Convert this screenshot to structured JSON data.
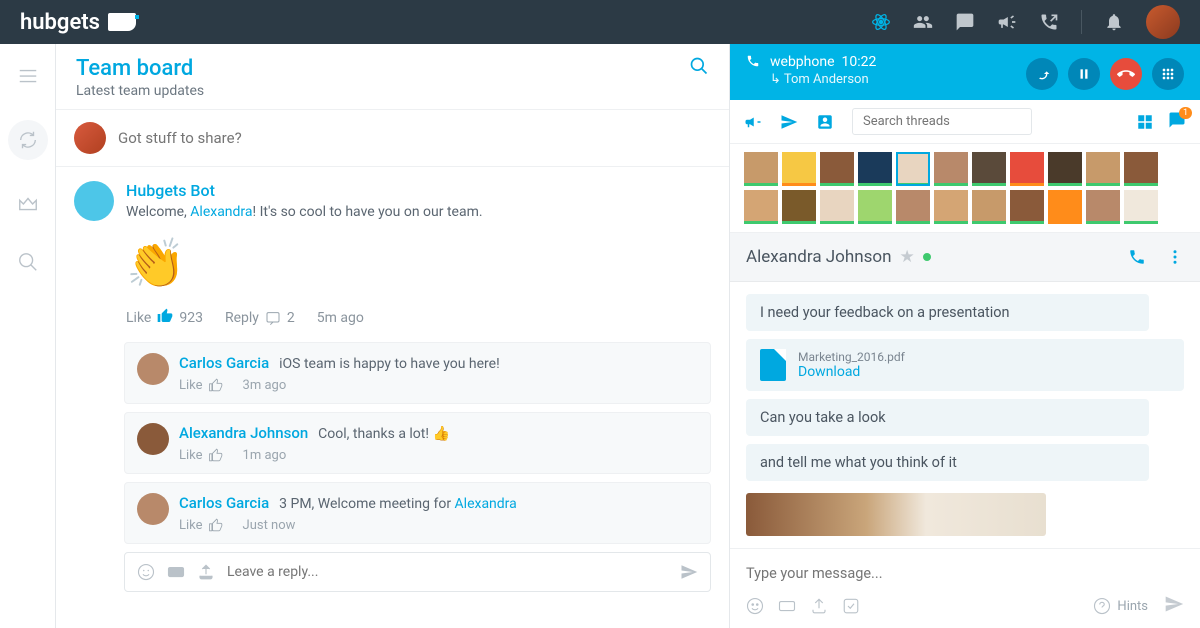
{
  "brand": "hubgets",
  "board": {
    "title": "Team board",
    "subtitle": "Latest team updates",
    "compose_placeholder": "Got stuff to share?",
    "post": {
      "author": "Hubgets Bot",
      "greeting_prefix": "Welcome, ",
      "mention": "Alexandra",
      "greeting_suffix": "! It's so cool to have you on our team.",
      "clap": "👏",
      "like_label": "Like",
      "like_count": "923",
      "reply_label": "Reply",
      "reply_count": "2",
      "age": "5m ago"
    },
    "replies": [
      {
        "author": "Carlos Garcia",
        "text": "iOS team is happy to have you here!",
        "like": "Like",
        "age": "3m ago"
      },
      {
        "author": "Alexandra Johnson",
        "text": "Cool, thanks a lot! 👍",
        "like": "Like",
        "age": "1m ago"
      },
      {
        "author": "Carlos Garcia",
        "text": "3 PM, Welcome meeting for ",
        "mention": "Alexandra",
        "like": "Like",
        "age": "Just now"
      }
    ],
    "reply_placeholder": "Leave a reply..."
  },
  "call": {
    "label": "webphone",
    "time": "10:22",
    "caller": "Tom Anderson"
  },
  "chat": {
    "search_placeholder": "Search threads",
    "badge": "1",
    "contact": "Alexandra Johnson",
    "messages": {
      "m1": "I need your feedback on a presentation",
      "file_name": "Marketing_2016.pdf",
      "file_action": "Download",
      "m2": "Can you take a look",
      "m3": "and tell me what you think of it"
    },
    "input_placeholder": "Type your message...",
    "hints": "Hints"
  }
}
